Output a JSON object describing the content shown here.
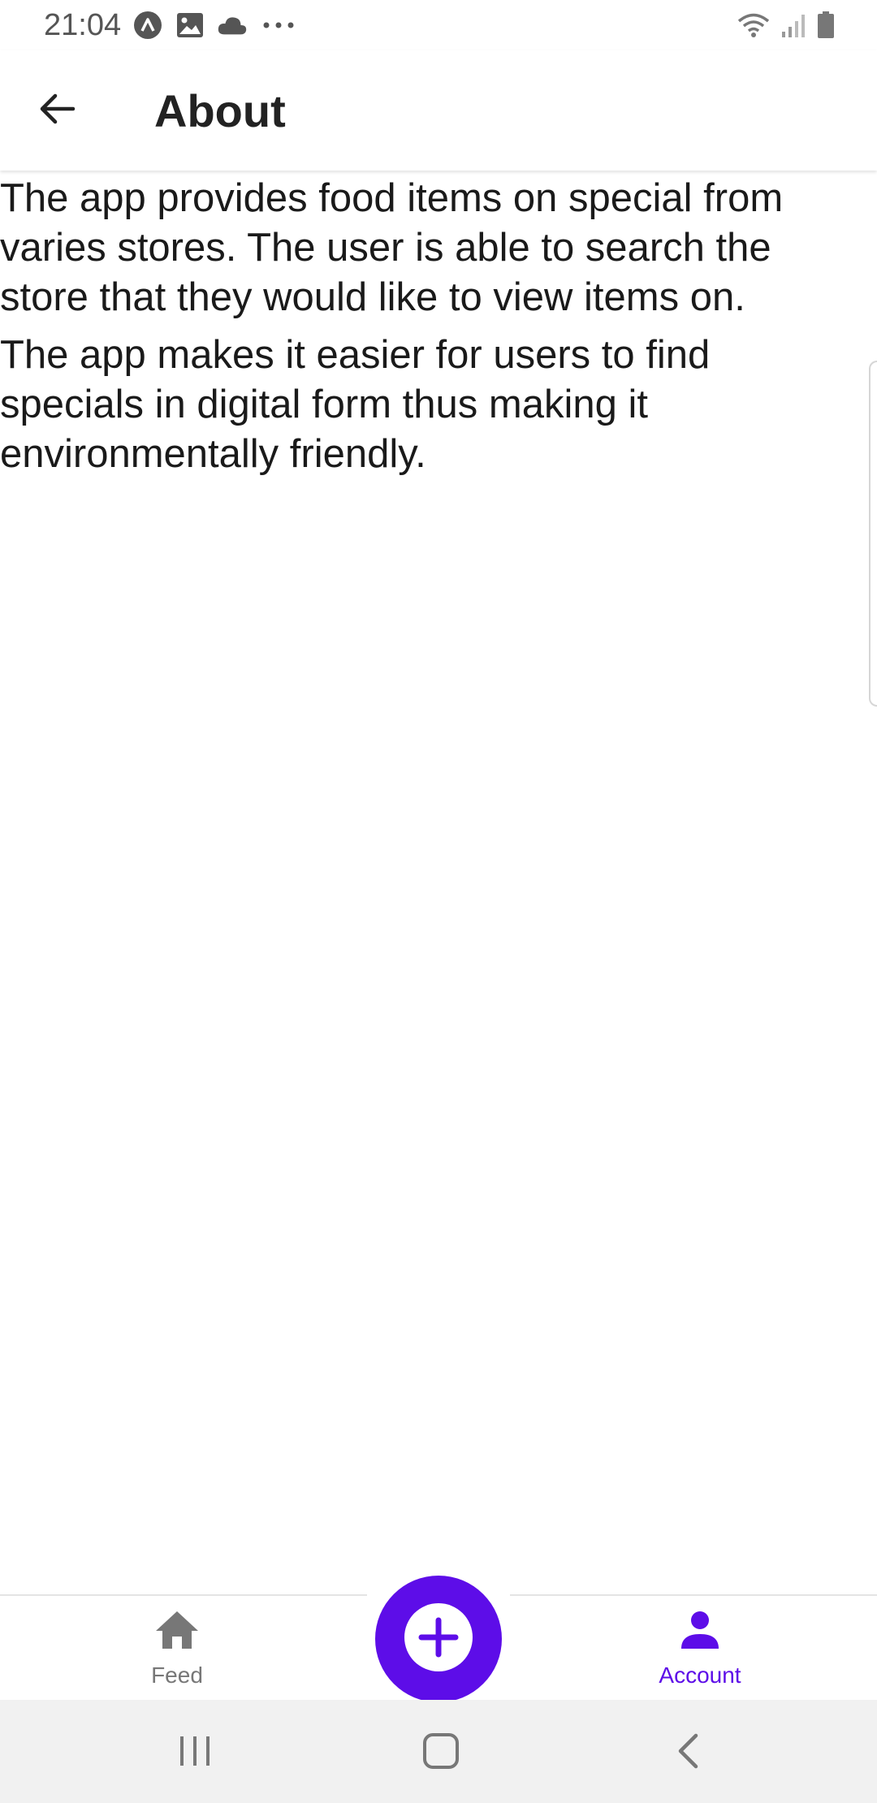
{
  "status_bar": {
    "time": "21:04",
    "left_icons": [
      "app-notification-icon",
      "gallery-icon",
      "cloud-icon",
      "more-dots-icon"
    ],
    "right_icons": [
      "wifi-icon",
      "signal-icon",
      "battery-icon"
    ]
  },
  "app_bar": {
    "title": "About",
    "back_icon": "arrow-left-icon"
  },
  "content": {
    "paragraphs": [
      "The app provides food items on special from varies stores. The user is able to search the store that they would like to view items on.",
      "The app makes it easier for users to find specials in digital form thus making it environmentally friendly."
    ]
  },
  "bottom_nav": {
    "items": [
      {
        "label": "Feed",
        "icon": "home-icon",
        "active": false
      },
      {
        "label": "Account",
        "icon": "person-icon",
        "active": true
      }
    ],
    "fab_icon": "plus-circle-icon"
  },
  "system_nav": {
    "buttons": [
      "recents-icon",
      "home-icon",
      "back-icon"
    ]
  },
  "colors": {
    "accent": "#5d0de8",
    "inactive": "#777777",
    "text": "#1a1a1a",
    "system_nav_bg": "#f1f1f1"
  }
}
